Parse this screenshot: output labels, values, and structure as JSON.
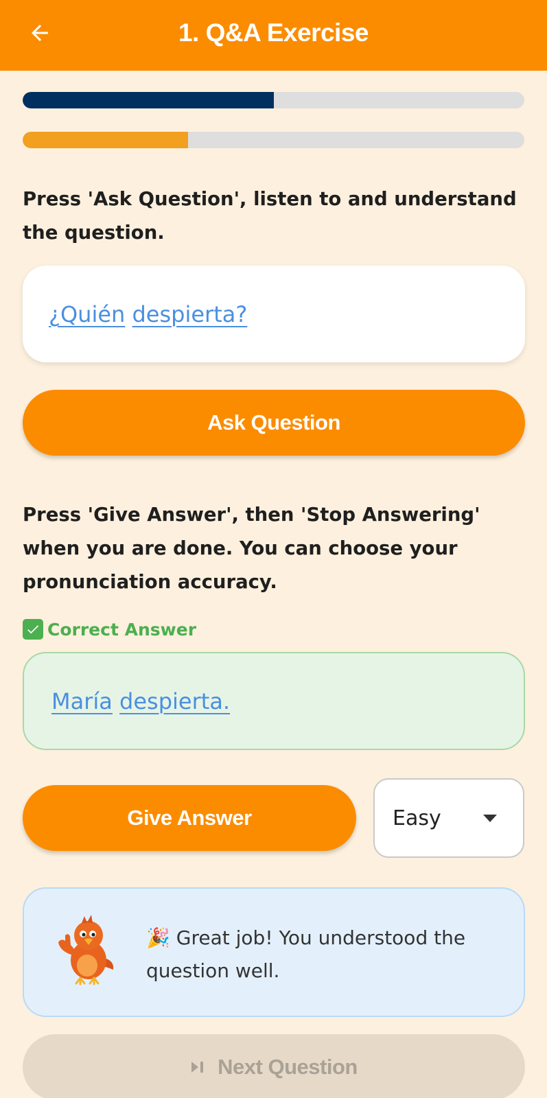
{
  "header": {
    "title": "1. Q&A Exercise",
    "back_icon": "arrow-left-icon"
  },
  "progress": {
    "overall": 0.5,
    "overall_color": "#00305f",
    "step": 0.33,
    "step_color": "#f2a01f"
  },
  "question_section": {
    "instruction": "Press 'Ask Question', listen to and understand the question.",
    "question_words": [
      "¿Quién",
      "despierta?"
    ],
    "ask_button_label": "Ask Question"
  },
  "answer_section": {
    "instruction": "Press 'Give Answer', then 'Stop Answering' when you are done. You can choose your pronunciation accuracy.",
    "correct_label": "Correct Answer",
    "answer_words": [
      "María",
      "despierta."
    ],
    "give_answer_label": "Give Answer",
    "difficulty_selected": "Easy"
  },
  "feedback": {
    "emoji": "🎉",
    "message": "Great job! You understood the question well."
  },
  "next_button": {
    "label": "Next Question",
    "icon": "skip-next-icon"
  },
  "colors": {
    "accent": "#fb8c00",
    "background": "#fdf0de",
    "link": "#4a8fe0",
    "success": "#4caf50"
  }
}
